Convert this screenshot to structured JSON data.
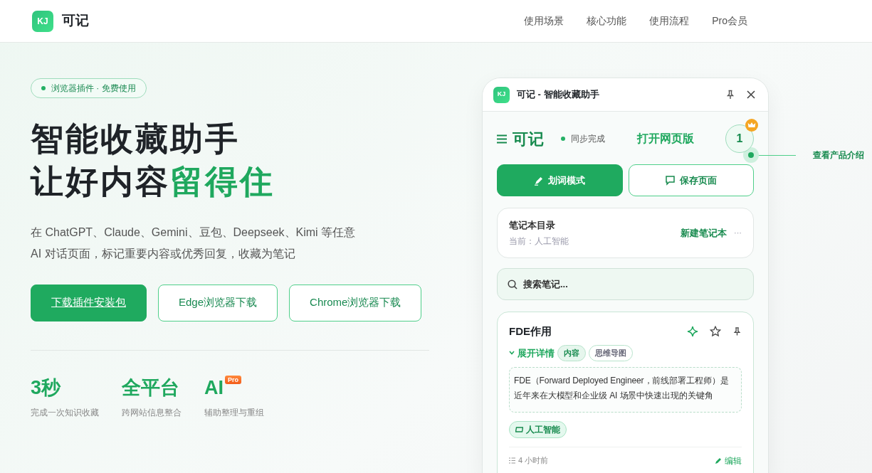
{
  "header": {
    "logo_mark": "KJ",
    "brand": "可记",
    "nav": [
      "使用场景",
      "核心功能",
      "使用流程",
      "Pro会员"
    ]
  },
  "hero": {
    "badge": "浏览器插件 · 免费使用",
    "title_line1": "智能收藏助手",
    "title_line2": "让好内容",
    "title_highlight": "留得住",
    "description": [
      "在 ChatGPT、Claude、Gemini、豆包、Deepseek、Kimi 等任意",
      "AI 对话页面，标记重要内容或优秀回复，收藏为笔记"
    ],
    "buttons": [
      {
        "label": "下载插件安装包",
        "kind": "primary"
      },
      {
        "label": "Edge浏览器下载",
        "kind": "outline"
      },
      {
        "label": "Chrome浏览器下载",
        "kind": "outline"
      }
    ],
    "stats": [
      {
        "value": "3秒",
        "caption": "完成一次知识收藏"
      },
      {
        "value": "全平台",
        "caption": "跨网站信息整合"
      },
      {
        "value": "AI",
        "tag": "Pro",
        "caption": "辅助整理与重组"
      }
    ]
  },
  "panel": {
    "logo_mark": "KJ",
    "title": "可记 - 智能收藏助手",
    "app_name": "可记",
    "sync_status": "同步完成",
    "open_web": "打开网页版",
    "avatar": "1",
    "actions": [
      {
        "label": "划词模式",
        "kind": "primary"
      },
      {
        "label": "保存页面",
        "kind": "outline"
      }
    ],
    "notebook": {
      "title": "笔记本目录",
      "current": "当前：人工智能",
      "new_button": "新建笔记本",
      "more": "···"
    },
    "search": {
      "placeholder": "搜索笔记..."
    },
    "note": {
      "title": "FDE作用",
      "expand": "展开详情",
      "views": [
        {
          "label": "内容",
          "selected": true
        },
        {
          "label": "思维导图",
          "selected": false
        }
      ],
      "content": "FDE（Forward Deployed Engineer，前线部署工程师）是近年来在大模型和企业级 AI 场景中快速出现的关键角",
      "tag": "人工智能",
      "time": "4 小时前",
      "edit": "编辑"
    }
  },
  "callout": "查看产品介绍"
}
